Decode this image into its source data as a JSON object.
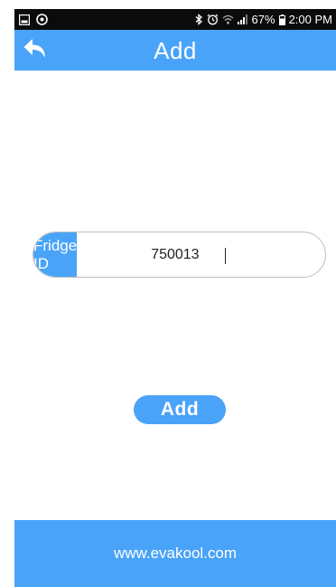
{
  "status_bar": {
    "icons_left": [
      "gallery-icon",
      "sync-icon"
    ],
    "icons_right": [
      "bluetooth-icon",
      "alarm-icon",
      "wifi-icon",
      "signal-icon",
      "battery-icon"
    ],
    "battery": "67%",
    "time": "2:00 PM"
  },
  "app_bar": {
    "title": "Add",
    "back_icon": "back-arrow-icon"
  },
  "form": {
    "field_label": "Fridge ID",
    "field_value": "750013"
  },
  "actions": {
    "add_label": "Add"
  },
  "footer": {
    "text": "www.evakool.com"
  },
  "colors": {
    "accent": "#49a3f8",
    "status_bar": "#0b0b0b",
    "background": "#ffffff"
  }
}
